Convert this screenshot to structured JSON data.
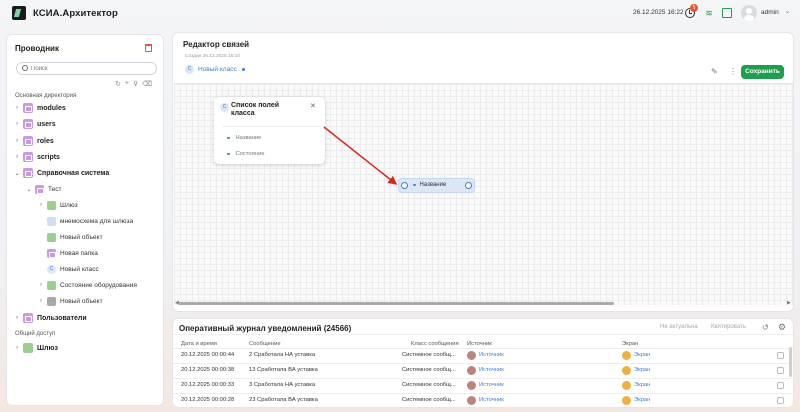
{
  "header": {
    "app_title": "КСИА.Архитектор",
    "datetime": "26.12.2025 16:22",
    "notifications_count": "5",
    "user": "admin"
  },
  "explorer": {
    "title": "Проводник",
    "search_placeholder": "Поиск",
    "main_dir_label": "Основная директория",
    "shared_label": "Общий доступ",
    "items": [
      {
        "label": "modules"
      },
      {
        "label": "users"
      },
      {
        "label": "roles"
      },
      {
        "label": "scripts"
      },
      {
        "label": "Справочная система"
      },
      {
        "label": "Тест"
      },
      {
        "label": "Шлюз"
      },
      {
        "label": "мнемосхема для шлюза"
      },
      {
        "label": "Новый объект"
      },
      {
        "label": "Новая папка"
      },
      {
        "label": "Новый класс"
      },
      {
        "label": "Состояние оборудования"
      },
      {
        "label": "Новый объект"
      },
      {
        "label": "Пользователи"
      },
      {
        "label": "Шлюз"
      }
    ]
  },
  "editor": {
    "title": "Редактор связей",
    "subtitle": "Создан 26.12.2025 15:10",
    "class_name": "Новый класс",
    "save_label": "Сохранить",
    "card": {
      "title": "Список полей класса",
      "fields": [
        "Название",
        "Состояние"
      ]
    },
    "node_label": "Название"
  },
  "journal": {
    "title": "Оперативный журнал уведомлений (24566)",
    "btn_irrelevant": "Не актуальна",
    "btn_acknowledge": "Квитировать",
    "columns": [
      "Дата и время",
      "Сообщение",
      "Класс сообщения",
      "Источник",
      "Экран"
    ],
    "rows": [
      {
        "date": "20.12.2025 00:00:44",
        "message": "2 Сработала НА уставка",
        "class": "Системное сообщ...",
        "source": "Источник",
        "screen": "Экран"
      },
      {
        "date": "20.12.2025 00:00:38",
        "message": "13 Сработала ВА уставка",
        "class": "Системное сообщ...",
        "source": "Источник",
        "screen": "Экран"
      },
      {
        "date": "20.12.2025 00:00:33",
        "message": "3 Сработала НА уставка",
        "class": "Системное сообщ...",
        "source": "Источник",
        "screen": "Экран"
      },
      {
        "date": "20.12.2025 00:00:28",
        "message": "23 Сработала ВА уставка",
        "class": "Системное сообщ...",
        "source": "Источник",
        "screen": "Экран"
      }
    ]
  },
  "colors": {
    "accent": "#3b7dd8",
    "save_green": "#1e9e4e",
    "arrow_red": "#d9261c",
    "folder_purple": "#c89be0"
  }
}
